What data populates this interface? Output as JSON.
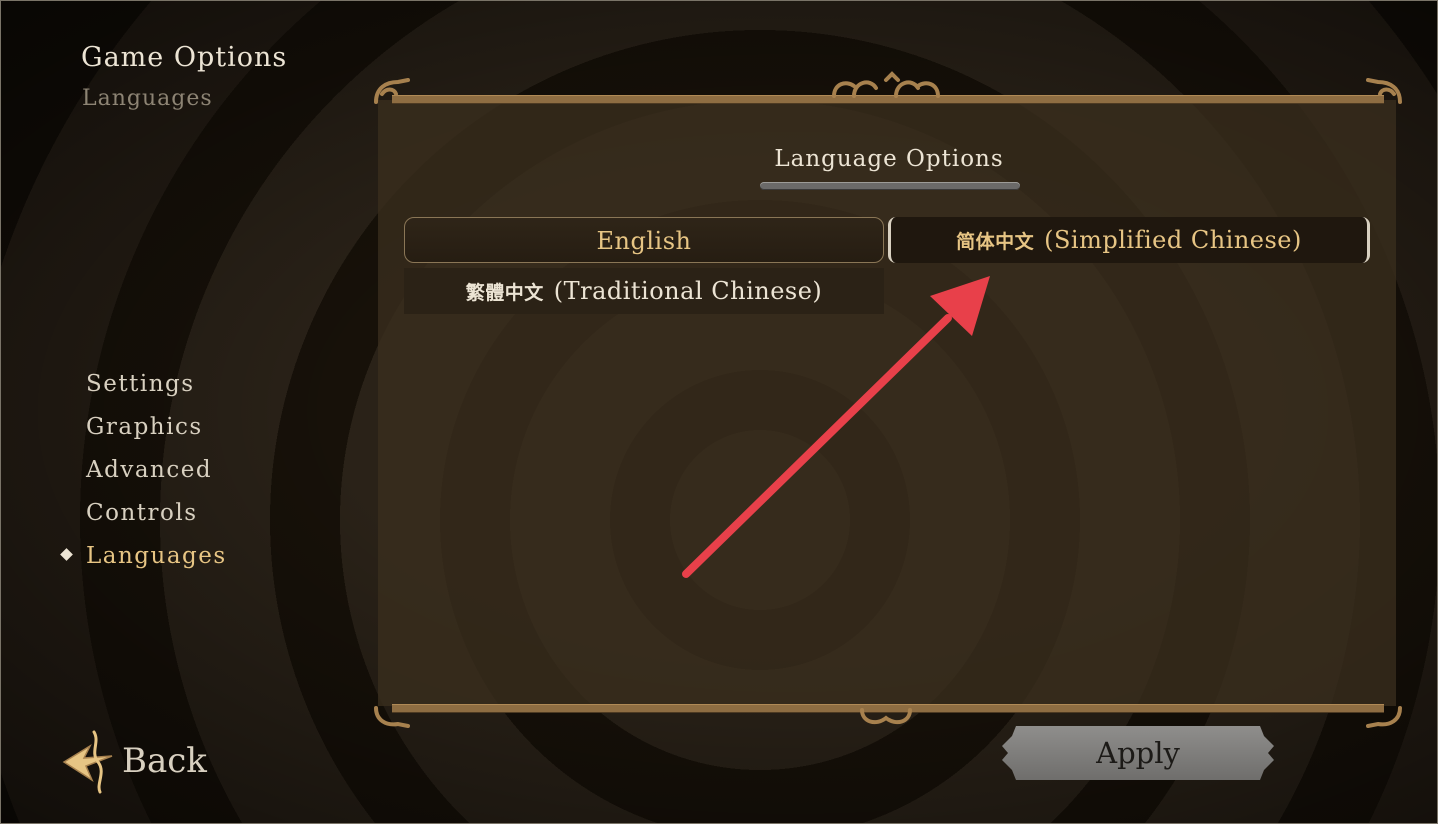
{
  "header": {
    "title": "Game Options",
    "subtitle": "Languages"
  },
  "nav": {
    "items": [
      {
        "label": "Settings",
        "active": false
      },
      {
        "label": "Graphics",
        "active": false
      },
      {
        "label": "Advanced",
        "active": false
      },
      {
        "label": "Controls",
        "active": false
      },
      {
        "label": "Languages",
        "active": true
      }
    ]
  },
  "panel": {
    "heading": "Language Options",
    "languages": [
      {
        "native": "",
        "name": "English",
        "state": "option"
      },
      {
        "native": "简体中文",
        "name": "(Simplified Chinese)",
        "state": "highlighted"
      },
      {
        "native": "繁體中文",
        "name": "(Traditional Chinese)",
        "state": "option"
      }
    ]
  },
  "footer": {
    "back_label": "Back",
    "apply_label": "Apply"
  },
  "colors": {
    "accent_gold": "#e7c584",
    "panel_brown": "#3a2e1e",
    "frame_bronze": "#8e6d42",
    "annotation_red": "#e8404a"
  },
  "icons": [
    "ornate-back-arrow-icon",
    "selection-diamond-icon",
    "frame-scroll-ornament-icon",
    "annotation-arrow"
  ]
}
